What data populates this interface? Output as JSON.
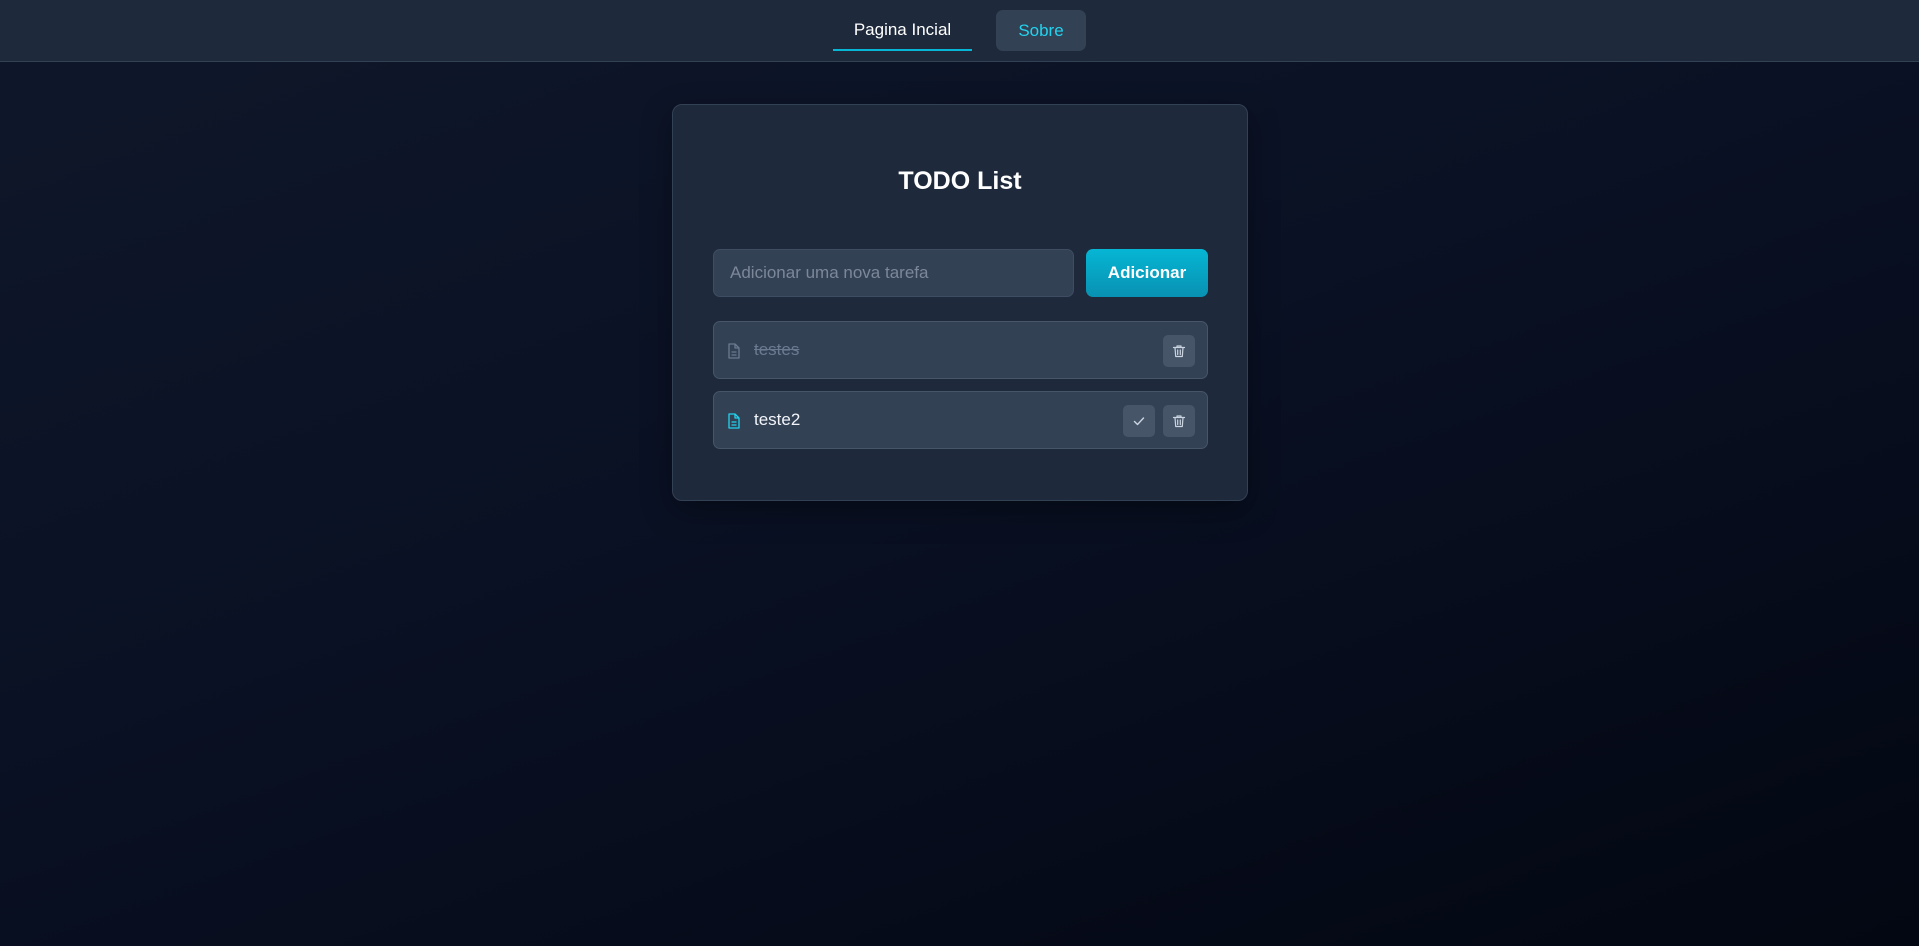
{
  "nav": {
    "home_label": "Pagina Incial",
    "about_label": "Sobre",
    "active": "home"
  },
  "todo": {
    "title": "TODO List",
    "input": {
      "placeholder": "Adicionar uma nova tarefa",
      "value": ""
    },
    "add_label": "Adicionar",
    "tasks": [
      {
        "text": "testes",
        "completed": true,
        "icon": "document-icon"
      },
      {
        "text": "teste2",
        "completed": false,
        "icon": "document-icon"
      }
    ]
  },
  "colors": {
    "accent": "#06b6d4",
    "surface": "#1e293b",
    "item_surface": "#334155",
    "background": "#0a1124"
  }
}
